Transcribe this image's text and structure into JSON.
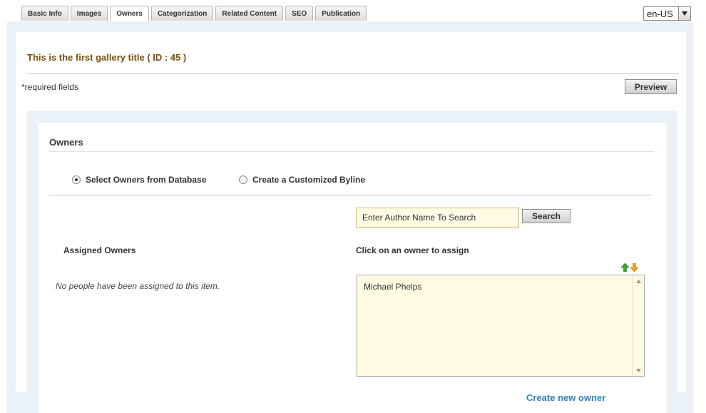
{
  "tabs": [
    {
      "label": "Basic Info"
    },
    {
      "label": "Images"
    },
    {
      "label": "Owners",
      "active": true
    },
    {
      "label": "Categorization"
    },
    {
      "label": "Related Content"
    },
    {
      "label": "SEO"
    },
    {
      "label": "Publication"
    }
  ],
  "language": {
    "selected": "en-US"
  },
  "page": {
    "title": "This is the first gallery title ( ID : 45 )",
    "required_note": "required fields",
    "required_marker": "*",
    "preview_label": "Preview"
  },
  "owners": {
    "section_title": "Owners",
    "radio_database": "Select Owners from Database",
    "radio_custom": "Create a Customized Byline",
    "selected_option": "database",
    "search_value": "Enter Author Name To Search",
    "search_button": "Search",
    "assigned_label": "Assigned Owners",
    "click_label": "Click on an owner to assign",
    "empty_note": "No people have been assigned to this item.",
    "available": [
      {
        "name": "Michael Phelps"
      }
    ],
    "create_link": "Create new owner"
  },
  "colors": {
    "title": "#7a4f0c",
    "panel_bg": "#eaf2f7",
    "field_bg": "#fffbe3",
    "link": "#2c82c1"
  }
}
